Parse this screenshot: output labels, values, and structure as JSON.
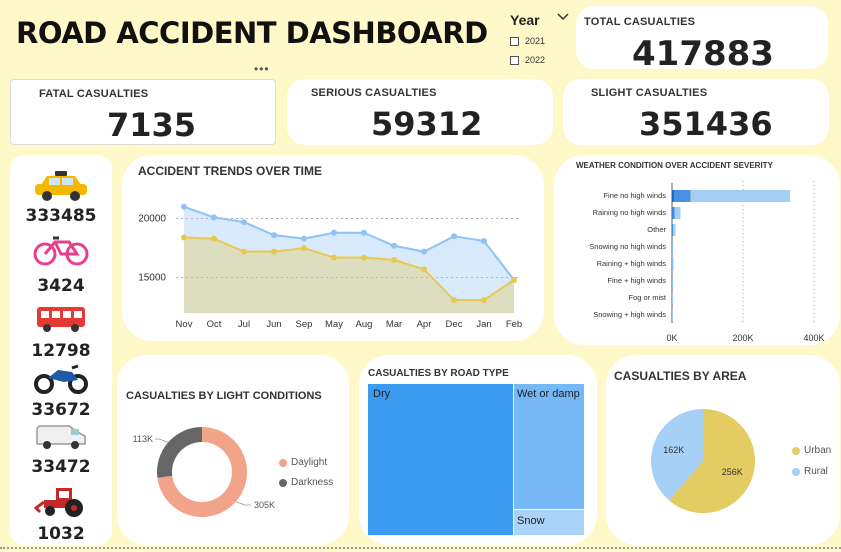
{
  "header": {
    "title": "ROAD ACCIDENT DASHBOARD",
    "more_icon": "more-dots-icon"
  },
  "slicer": {
    "label": "Year",
    "options": [
      "2021",
      "2022"
    ]
  },
  "kpis": {
    "total": {
      "label": "TOTAL CASUALTIES",
      "value": "417883"
    },
    "fatal": {
      "label": "FATAL CASUALTIES",
      "value": "7135"
    },
    "serious": {
      "label": "SERIOUS CASUALTIES",
      "value": "59312"
    },
    "slight": {
      "label": "SLIGHT CASUALTIES",
      "value": "351436"
    }
  },
  "vehicles": [
    {
      "icon": "taxi-car-icon",
      "value": "333485"
    },
    {
      "icon": "bicycle-icon",
      "value": "3424"
    },
    {
      "icon": "bus-icon",
      "value": "12798"
    },
    {
      "icon": "motorcycle-icon",
      "value": "33672"
    },
    {
      "icon": "van-icon",
      "value": "33472"
    },
    {
      "icon": "tractor-icon",
      "value": "1032"
    }
  ],
  "chart_data": [
    {
      "type": "area",
      "title": "ACCIDENT TRENDS OVER TIME",
      "categories": [
        "Nov",
        "Oct",
        "Jul",
        "Jun",
        "Sep",
        "May",
        "Aug",
        "Mar",
        "Apr",
        "Dec",
        "Jan",
        "Feb"
      ],
      "series": [
        {
          "values": [
            21000,
            20100,
            19700,
            18600,
            18300,
            18800,
            18800,
            17700,
            17200,
            18500,
            18100,
            14800
          ],
          "color": "#8EC3F5"
        },
        {
          "values": [
            18400,
            18300,
            17200,
            17200,
            17500,
            16700,
            16700,
            16500,
            15700,
            13100,
            13100,
            14800
          ],
          "color": "#E8C94E"
        }
      ],
      "yticks": [
        15000,
        20000
      ],
      "ytick_labels": [
        "15000",
        "20000"
      ],
      "ylim": [
        12000,
        22000
      ]
    },
    {
      "type": "bar",
      "title": "WEATHER CONDITION OVER ACCIDENT SEVERITY",
      "orientation": "horizontal",
      "categories": [
        "Fine no high winds",
        "Raining no high winds",
        "Other",
        "Snowing no high winds",
        "Raining + high winds",
        "Fine + high winds",
        "Fog or mist",
        "Snowing + high winds"
      ],
      "series": [
        {
          "values": [
            5500,
            800,
            300,
            100,
            100,
            120,
            50,
            30
          ],
          "color": "#1F63B3"
        },
        {
          "values": [
            47000,
            7000,
            2500,
            600,
            800,
            500,
            300,
            200
          ],
          "color": "#4A90E2"
        },
        {
          "values": [
            280000,
            16000,
            7000,
            2600,
            3200,
            2100,
            900,
            600
          ],
          "color": "#A5CEF3"
        }
      ],
      "xticks": [
        0,
        200000,
        400000
      ],
      "xtick_labels": [
        "0K",
        "200K",
        "400K"
      ],
      "xlim": [
        0,
        400000
      ]
    },
    {
      "type": "pie",
      "title": "CASUALTIES BY LIGHT CONDITIONS",
      "donut": true,
      "labels": [
        "Daylight",
        "Darkness"
      ],
      "values": [
        305,
        113
      ],
      "data_labels": [
        "305K",
        "113K"
      ],
      "colors": [
        "#F2A48A",
        "#666666"
      ]
    },
    {
      "type": "treemap",
      "title": "CASUALTIES BY ROAD TYPE",
      "labels": [
        "Dry",
        "Wet or damp",
        "Snow"
      ],
      "colors": [
        "#3A9BF0",
        "#75B8F5",
        "#A9D3F8"
      ]
    },
    {
      "type": "pie",
      "title": "CASUALTIES BY AREA",
      "labels": [
        "Urban",
        "Rural"
      ],
      "values": [
        256,
        162
      ],
      "data_labels": [
        "256K",
        "162K"
      ],
      "colors": [
        "#E3CC62",
        "#A7D0F6"
      ]
    }
  ]
}
